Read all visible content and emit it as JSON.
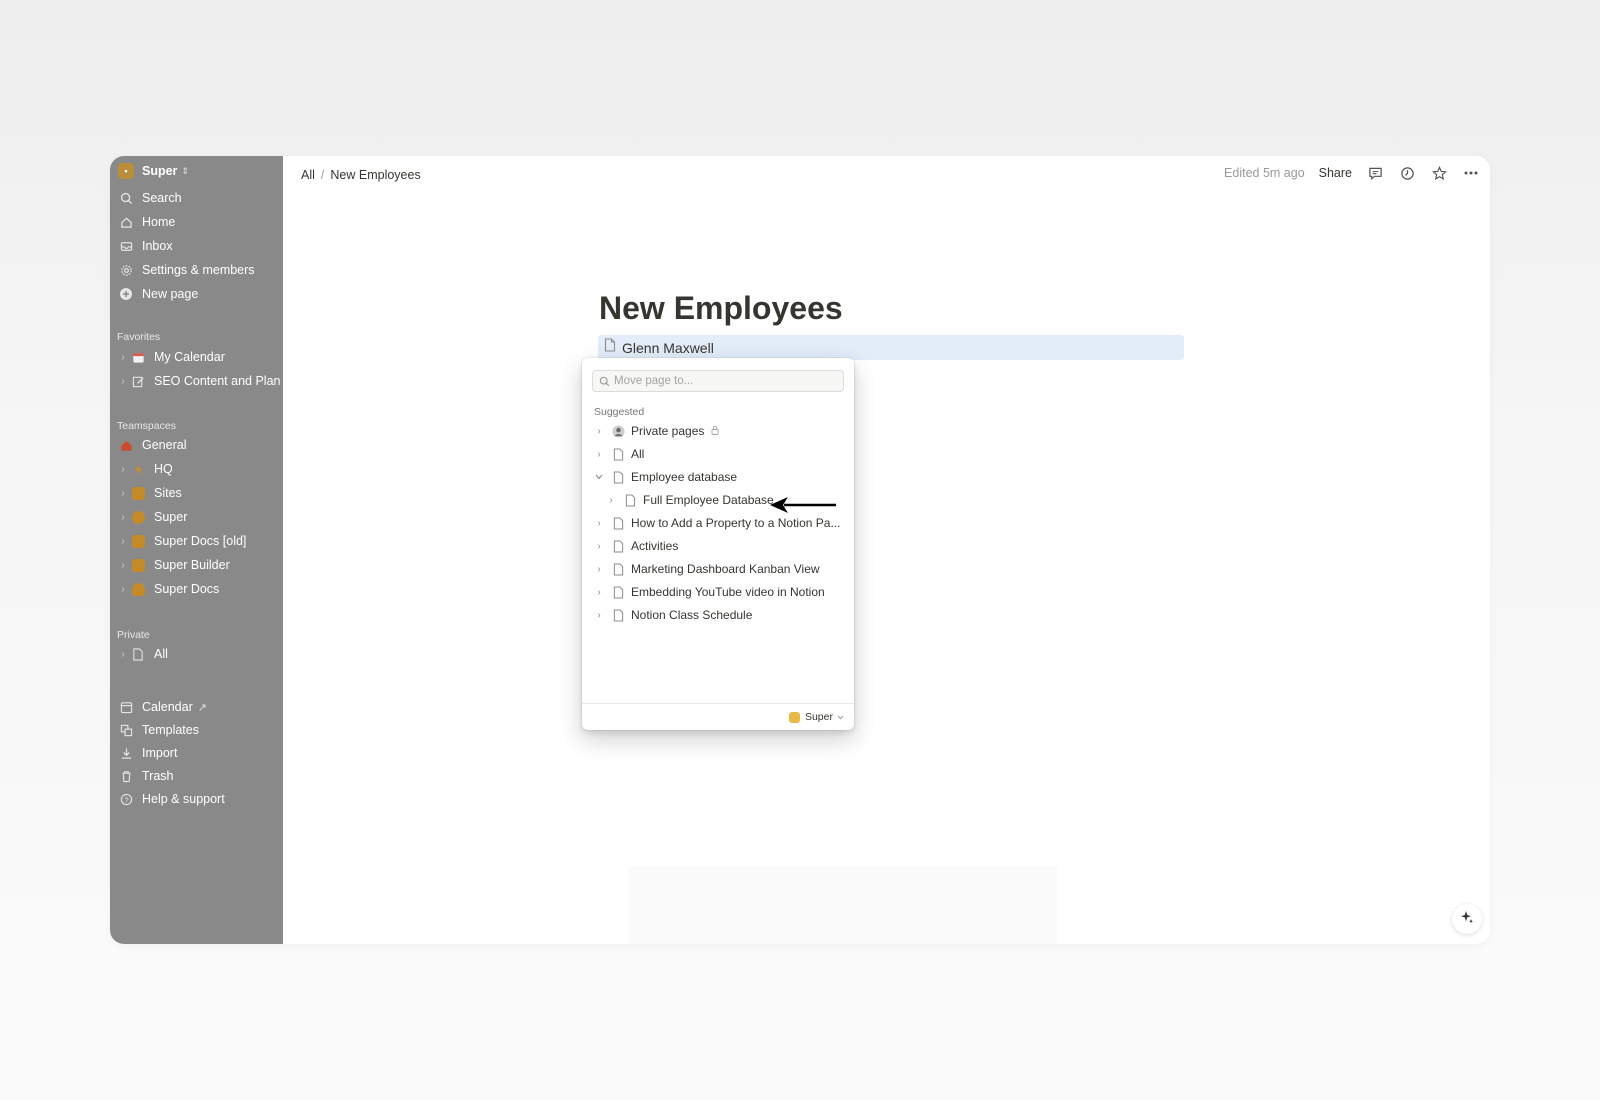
{
  "sidebar": {
    "workspace": "Super",
    "nav": [
      {
        "label": "Search",
        "icon": "search-icon"
      },
      {
        "label": "Home",
        "icon": "home-icon"
      },
      {
        "label": "Inbox",
        "icon": "inbox-icon"
      },
      {
        "label": "Settings & members",
        "icon": "gear-icon"
      },
      {
        "label": "New page",
        "icon": "plus-circle-icon"
      }
    ],
    "favorites_title": "Favorites",
    "favorites": [
      {
        "label": "My Calendar",
        "icon": "calendar-icon"
      },
      {
        "label": "SEO Content and Plan",
        "icon": "edit-icon"
      }
    ],
    "teamspaces_title": "Teamspaces",
    "teamspaces": [
      {
        "label": "General",
        "icon": "home-icon",
        "color": "#c94c2c"
      },
      {
        "label": "HQ",
        "icon": "bolt-icon",
        "color": "#d08a2a"
      },
      {
        "label": "Sites",
        "icon": "workspace-icon",
        "color": "#d4952c"
      },
      {
        "label": "Super",
        "icon": "workspace-icon",
        "color": "#d4952c"
      },
      {
        "label": "Super Docs [old]",
        "icon": "workspace-icon",
        "color": "#d4952c"
      },
      {
        "label": "Super Builder",
        "icon": "workspace-icon",
        "color": "#d4952c"
      },
      {
        "label": "Super Docs",
        "icon": "workspace-icon",
        "color": "#d4952c"
      }
    ],
    "private_title": "Private",
    "private": [
      {
        "label": "All",
        "icon": "page-icon"
      }
    ],
    "bottom": [
      {
        "label": "Calendar",
        "icon": "calendar-icon"
      },
      {
        "label": "Templates",
        "icon": "templates-icon"
      },
      {
        "label": "Import",
        "icon": "import-icon"
      },
      {
        "label": "Trash",
        "icon": "trash-icon"
      },
      {
        "label": "Help & support",
        "icon": "help-icon"
      }
    ]
  },
  "breadcrumb": {
    "root": "All",
    "sep": "/",
    "current": "New Employees"
  },
  "topbar": {
    "edited": "Edited 5m ago",
    "share": "Share"
  },
  "page": {
    "title": "New Employees",
    "selected_row": "Glenn Maxwell"
  },
  "move_popup": {
    "search_placeholder": "Move page to...",
    "section_title": "Suggested",
    "items": [
      {
        "label": "Private pages",
        "icon": "avatar-icon",
        "indent": 0,
        "expanded": false,
        "locked": true
      },
      {
        "label": "All",
        "icon": "page-icon",
        "indent": 0,
        "expanded": false
      },
      {
        "label": "Employee database",
        "icon": "page-icon",
        "indent": 0,
        "expanded": true
      },
      {
        "label": "Full Employee Database",
        "icon": "page-icon",
        "indent": 1,
        "expanded": false
      },
      {
        "label": "How to Add a Property to a Notion Pa...",
        "icon": "page-icon",
        "indent": 0,
        "expanded": false
      },
      {
        "label": "Activities",
        "icon": "page-icon",
        "indent": 0,
        "expanded": false
      },
      {
        "label": "Marketing Dashboard Kanban View",
        "icon": "page-icon",
        "indent": 0,
        "expanded": false
      },
      {
        "label": "Embedding YouTube video in Notion",
        "icon": "page-icon",
        "indent": 0,
        "expanded": false
      },
      {
        "label": "Notion Class Schedule",
        "icon": "page-icon",
        "indent": 0,
        "expanded": false
      }
    ],
    "footer_workspace": "Super"
  }
}
